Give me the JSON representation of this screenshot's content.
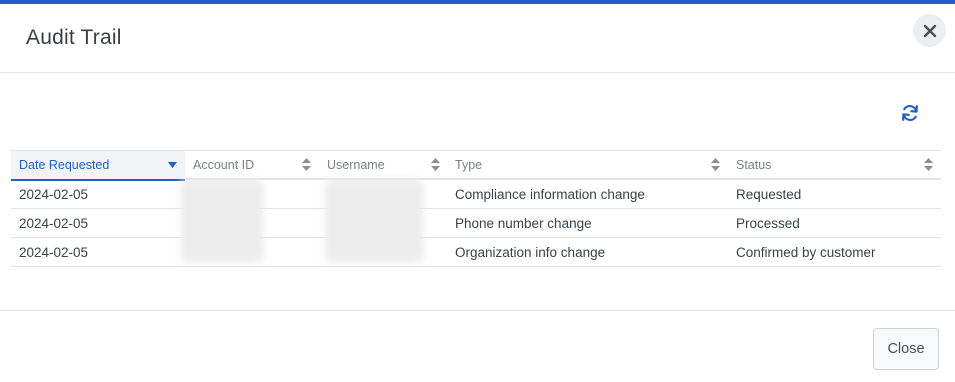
{
  "dialog": {
    "title": "Audit Trail",
    "close_icon": "close-x-icon",
    "refresh_icon": "refresh-icon",
    "accent_color": "#1f5fc9"
  },
  "table": {
    "columns": [
      {
        "key": "date",
        "label": "Date Requested",
        "sorted": "descending",
        "sort_icon": "sort-down-caret-icon"
      },
      {
        "key": "account",
        "label": "Account ID",
        "sort_icon": "sort-both-icon"
      },
      {
        "key": "username",
        "label": "Username",
        "sort_icon": "sort-both-icon"
      },
      {
        "key": "type",
        "label": "Type",
        "sort_icon": "sort-both-icon"
      },
      {
        "key": "status",
        "label": "Status",
        "sort_icon": "sort-both-icon"
      }
    ],
    "rows": [
      {
        "date": "2024-02-05",
        "type": "Compliance information change",
        "status": "Requested"
      },
      {
        "date": "2024-02-05",
        "type": "Phone number change",
        "status": "Processed"
      },
      {
        "date": "2024-02-05",
        "type": "Organization info change",
        "status": "Confirmed by customer"
      }
    ]
  },
  "footer": {
    "close_label": "Close"
  }
}
